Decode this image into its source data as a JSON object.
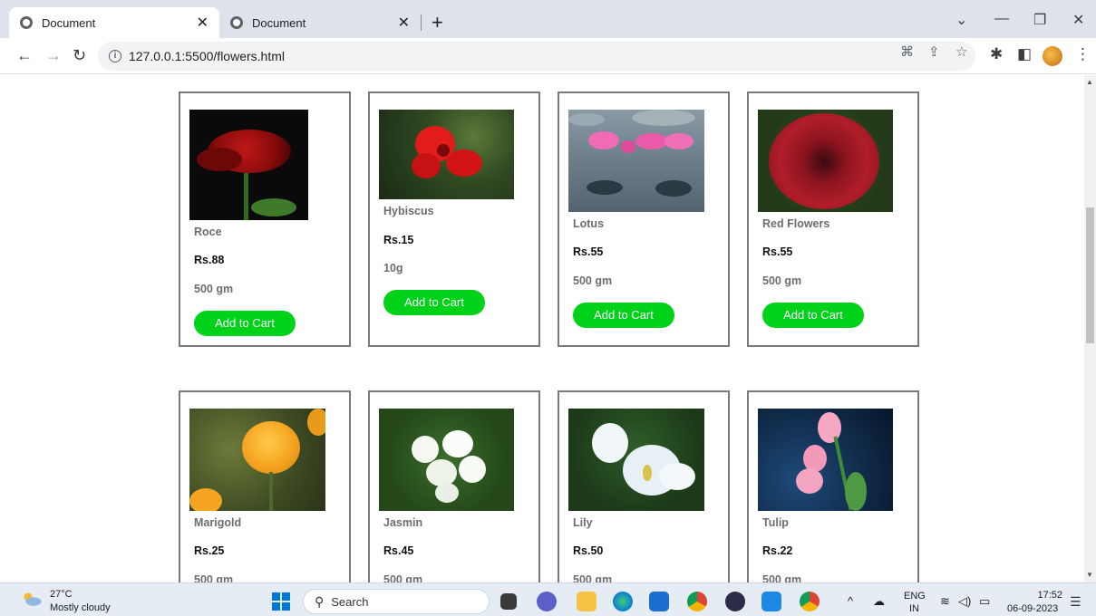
{
  "browser": {
    "tabs": [
      {
        "title": "Document",
        "active": true
      },
      {
        "title": "Document",
        "active": false
      }
    ],
    "url": "127.0.0.1:5500/flowers.html"
  },
  "products": [
    {
      "name": "Roce",
      "price": "Rs.88",
      "weight": "500 gm",
      "button": "Add to Cart"
    },
    {
      "name": "Hybiscus",
      "price": "Rs.15",
      "weight": "10g",
      "button": "Add to Cart"
    },
    {
      "name": "Lotus",
      "price": "Rs.55",
      "weight": "500 gm",
      "button": "Add to Cart"
    },
    {
      "name": "Red Flowers",
      "price": "Rs.55",
      "weight": "500 gm",
      "button": "Add to Cart"
    },
    {
      "name": "Marigold",
      "price": "Rs.25",
      "weight": "500 gm"
    },
    {
      "name": "Jasmin",
      "price": "Rs.45",
      "weight": "500 gm"
    },
    {
      "name": "Lily",
      "price": "Rs.50",
      "weight": "500 gm"
    },
    {
      "name": "Tulip",
      "price": "Rs.22",
      "weight": "500 gm"
    }
  ],
  "colors": {
    "button_green": "#00d119",
    "card_border": "#7a7a7a",
    "name_gray": "#6d6d6d"
  },
  "taskbar": {
    "temperature": "27°C",
    "weather": "Mostly cloudy",
    "search_label": "Search",
    "lang_line1": "ENG",
    "lang_line2": "IN",
    "time": "17:52",
    "date": "06-09-2023"
  }
}
